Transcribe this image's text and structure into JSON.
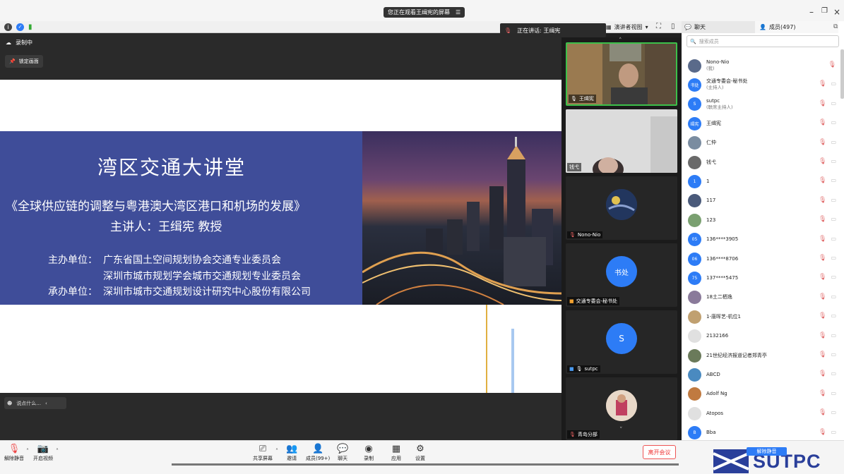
{
  "system_bar": {
    "share_notice": "您正在观看王缉宪的屏幕",
    "share_menu_icon": "menu-icon"
  },
  "toolbar": {
    "speaking_label": "正在讲话: 王缉宪",
    "presenter_view": "演讲者视图",
    "chat_tab": "聊天",
    "members_tab": "成员(497)"
  },
  "share": {
    "recording": "录制中",
    "pin_screen": "锁定画面",
    "comment_placeholder": "说点什么..."
  },
  "slide": {
    "title": "湾区交通大讲堂",
    "subtitle": "《全球供应链的调整与粤港澳大湾区港口和机场的发展》",
    "speaker": "主讲人：王缉宪  教授",
    "host_label": "主办单位：",
    "host_1": "广东省国土空间规划协会交通专业委员会",
    "host_2": "深圳市城市规划学会城市交通规划专业委员会",
    "organizer_label": "承办单位：",
    "organizer": "深圳市城市交通规划设计研究中心股份有限公司"
  },
  "video_tiles": [
    {
      "name": "王缉宪",
      "avatar_text": ""
    },
    {
      "name": "钱弋",
      "avatar_text": ""
    },
    {
      "name": "Nono-Nio",
      "avatar_text": ""
    },
    {
      "name": "交通专委会-秘书处",
      "avatar_text": "书处"
    },
    {
      "name": "sutpc",
      "avatar_text": "S"
    },
    {
      "name": "青岛分部",
      "avatar_text": ""
    }
  ],
  "members": {
    "search_placeholder": "搜索成员",
    "list": [
      {
        "name": "Nono-Nio",
        "sub": "(我)",
        "avatar": "",
        "color": "#5a6a8a"
      },
      {
        "name": "交通专委会-秘书处",
        "sub": "(主持人)",
        "avatar": "书处",
        "color": "#2d7cf6"
      },
      {
        "name": "sutpc",
        "sub": "(联席主持人)",
        "avatar": "S",
        "color": "#2d7cf6"
      },
      {
        "name": "王缉宪",
        "sub": "",
        "avatar": "缉宪",
        "color": "#2d7cf6"
      },
      {
        "name": "仁仲",
        "sub": "",
        "avatar": "",
        "color": "#7a8ca0"
      },
      {
        "name": "钱弋",
        "sub": "",
        "avatar": "",
        "color": "#6a6a6a"
      },
      {
        "name": "1",
        "sub": "",
        "avatar": "1",
        "color": "#2d7cf6"
      },
      {
        "name": "117",
        "sub": "",
        "avatar": "",
        "color": "#4a5a7a"
      },
      {
        "name": "123",
        "sub": "",
        "avatar": "",
        "color": "#7aa070"
      },
      {
        "name": "136****3905",
        "sub": "",
        "avatar": "05",
        "color": "#2d7cf6"
      },
      {
        "name": "136****8706",
        "sub": "",
        "avatar": "06",
        "color": "#2d7cf6"
      },
      {
        "name": "137****5475",
        "sub": "",
        "avatar": "75",
        "color": "#2d7cf6"
      },
      {
        "name": "18土二栖逸",
        "sub": "",
        "avatar": "",
        "color": "#8a7a9a"
      },
      {
        "name": "1-唐晖艺-机位1",
        "sub": "",
        "avatar": "",
        "color": "#c0a070"
      },
      {
        "name": "2132166",
        "sub": "",
        "avatar": "",
        "color": "#e0e0e0"
      },
      {
        "name": "21世纪经济报道记者郑青亭",
        "sub": "",
        "avatar": "",
        "color": "#6a7a5a"
      },
      {
        "name": "ABCD",
        "sub": "",
        "avatar": "",
        "color": "#4a8ac0"
      },
      {
        "name": "Adolf Ng",
        "sub": "",
        "avatar": "",
        "color": "#c07a40"
      },
      {
        "name": "Atopos",
        "sub": "",
        "avatar": "",
        "color": "#e0e0e0"
      },
      {
        "name": "Bba",
        "sub": "",
        "avatar": "B",
        "color": "#2d7cf6"
      }
    ]
  },
  "bottom": {
    "unmute": "解除静音",
    "video": "开启视频",
    "share_screen": "共享屏幕",
    "invite": "邀请",
    "members": "成员(99+)",
    "chat": "聊天",
    "record": "录制",
    "apps": "应用",
    "settings": "设置",
    "leave": "离开会议",
    "unmute_all": "解除静音",
    "logo": "SUTPC"
  },
  "colors": {
    "banner_blue": "#3f4d99",
    "accent_blue": "#2d7cf6",
    "leave_red": "#e33333",
    "logo_blue": "#2a3f9a"
  }
}
